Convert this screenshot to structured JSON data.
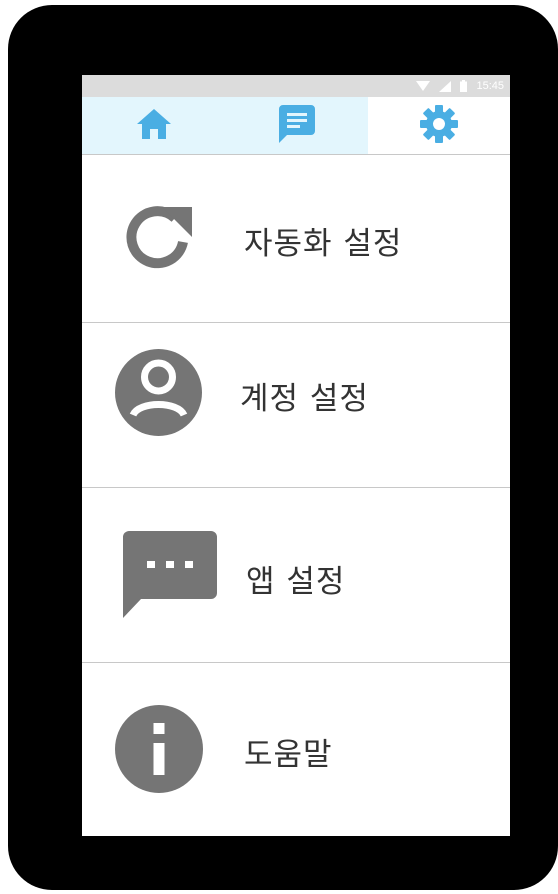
{
  "status_bar": {
    "time": "15:45",
    "icons": [
      "wifi-icon",
      "signal-icon",
      "battery-icon"
    ]
  },
  "tabs": [
    {
      "name": "home",
      "icon": "home-icon",
      "active": false
    },
    {
      "name": "chat",
      "icon": "chat-icon",
      "active": false
    },
    {
      "name": "settings",
      "icon": "gear-icon",
      "active": true
    }
  ],
  "menu": {
    "items": [
      {
        "label": "자동화 설정",
        "icon": "refresh-icon"
      },
      {
        "label": "계정 설정",
        "icon": "account-circle-icon"
      },
      {
        "label": "앱 설정",
        "icon": "message-icon"
      },
      {
        "label": "도움말",
        "icon": "info-icon"
      }
    ]
  },
  "colors": {
    "accent": "#4aaee3",
    "tab_inactive_bg": "#e3f6fd",
    "icon_gray": "#757575",
    "text": "#333333",
    "device": "#000000",
    "status_bar": "#dcdcdc"
  }
}
